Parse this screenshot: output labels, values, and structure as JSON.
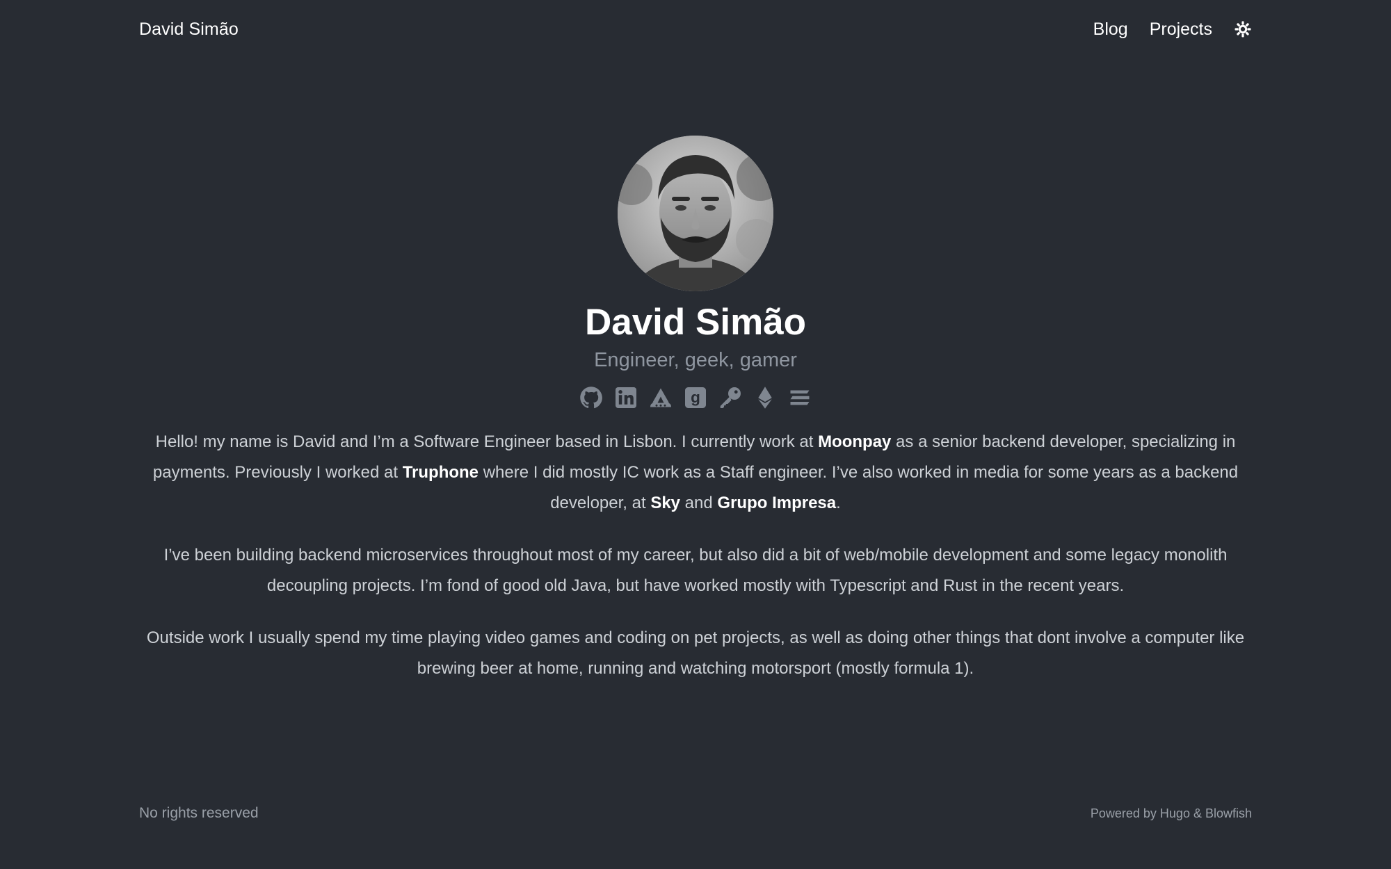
{
  "header": {
    "site_title": "David Simão",
    "nav": [
      "Blog",
      "Projects"
    ],
    "theme_toggle_icon": "sun-gear-icon"
  },
  "hero": {
    "name": "David Simão",
    "tagline": "Engineer, geek, gamer",
    "avatar_icon": "avatar-photo",
    "socials": [
      "github-icon",
      "linkedin-icon",
      "cloud-mountain-icon",
      "goodreads-icon",
      "key-icon",
      "ethereum-icon",
      "stack-icon"
    ]
  },
  "bio": {
    "p1_a": "Hello! my name is David and I’m a Software Engineer based in Lisbon. I currently work at ",
    "p1_link1": "Moonpay",
    "p1_b": " as a senior backend developer, specializing in payments. Previously I worked at ",
    "p1_link2": "Truphone",
    "p1_c": " where I did mostly IC work as a Staff engineer. I’ve also worked in media for some years as a backend developer, at ",
    "p1_link3": "Sky",
    "p1_d": " and ",
    "p1_link4": "Grupo Impresa",
    "p1_e": ".",
    "p2": "I’ve been building backend microservices throughout most of my career, but also did a bit of web/mobile development and some legacy monolith decoupling projects. I’m fond of good old Java, but have worked mostly with Typescript and Rust in the recent years.",
    "p3": "Outside work I usually spend my time playing video games and coding on pet projects, as well as doing other things that dont involve a computer like brewing beer at home, running and watching motorsport (mostly formula 1)."
  },
  "footer": {
    "left": "No rights reserved",
    "powered_prefix": "Powered by ",
    "hugo": "Hugo",
    "amp": " & ",
    "blowfish": "Blowfish"
  },
  "colors": {
    "background": "#282c33",
    "text": "#d8dbe0",
    "muted": "#8f96a0",
    "icon": "#7f8690"
  }
}
